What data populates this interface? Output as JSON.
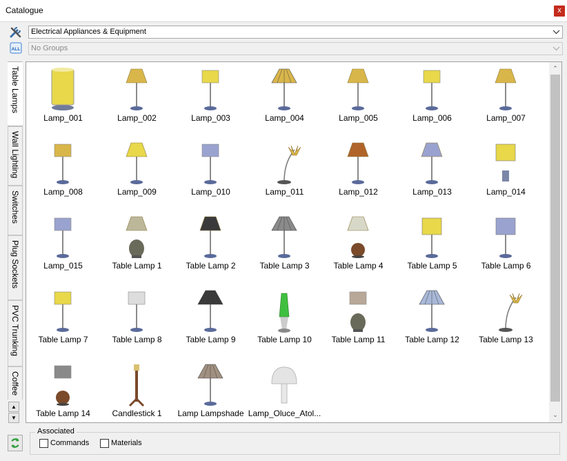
{
  "window": {
    "title": "Catalogue",
    "close_label": "x"
  },
  "filters": {
    "category_value": "Electrical Appliances & Equipment",
    "group_value": "No Groups",
    "all_badge": "ALL"
  },
  "tabs": [
    {
      "label": "Table Lamps",
      "active": true
    },
    {
      "label": "Wall Lighting",
      "active": false
    },
    {
      "label": "Switches",
      "active": false
    },
    {
      "label": "Plug Sockets",
      "active": false
    },
    {
      "label": "PVC Trunking",
      "active": false
    },
    {
      "label": "Coffee",
      "active": false
    }
  ],
  "items": [
    {
      "label": "Lamp_001"
    },
    {
      "label": "Lamp_002"
    },
    {
      "label": "Lamp_003"
    },
    {
      "label": "Lamp_004"
    },
    {
      "label": "Lamp_005"
    },
    {
      "label": "Lamp_006"
    },
    {
      "label": "Lamp_007"
    },
    {
      "label": "Lamp_008"
    },
    {
      "label": "Lamp_009"
    },
    {
      "label": "Lamp_010"
    },
    {
      "label": "Lamp_011"
    },
    {
      "label": "Lamp_012"
    },
    {
      "label": "Lamp_013"
    },
    {
      "label": "Lamp_014"
    },
    {
      "label": "Lamp_015"
    },
    {
      "label": "Table Lamp 1"
    },
    {
      "label": "Table Lamp 2"
    },
    {
      "label": "Table Lamp 3"
    },
    {
      "label": "Table Lamp 4"
    },
    {
      "label": "Table Lamp 5"
    },
    {
      "label": "Table Lamp 6"
    },
    {
      "label": "Table Lamp 7"
    },
    {
      "label": "Table Lamp 8"
    },
    {
      "label": "Table Lamp 9"
    },
    {
      "label": "Table Lamp 10"
    },
    {
      "label": "Table Lamp 11"
    },
    {
      "label": "Table Lamp 12"
    },
    {
      "label": "Table Lamp 13"
    },
    {
      "label": "Table Lamp 14"
    },
    {
      "label": "Candlestick 1"
    },
    {
      "label": "Lamp Lampshade"
    },
    {
      "label": "Lamp_Oluce_Atol..."
    }
  ],
  "associated": {
    "legend": "Associated",
    "commands_label": "Commands",
    "materials_label": "Materials",
    "commands_checked": false,
    "materials_checked": false
  },
  "colors": {
    "accent_close": "#c42b1c",
    "shade_yellow": "#e8d84a",
    "shade_gold": "#d9b64a",
    "shade_brown": "#b0642a",
    "shade_blue": "#9aa3cf",
    "shade_grey": "#8a8a8a",
    "shade_dark": "#3a3a3a"
  }
}
